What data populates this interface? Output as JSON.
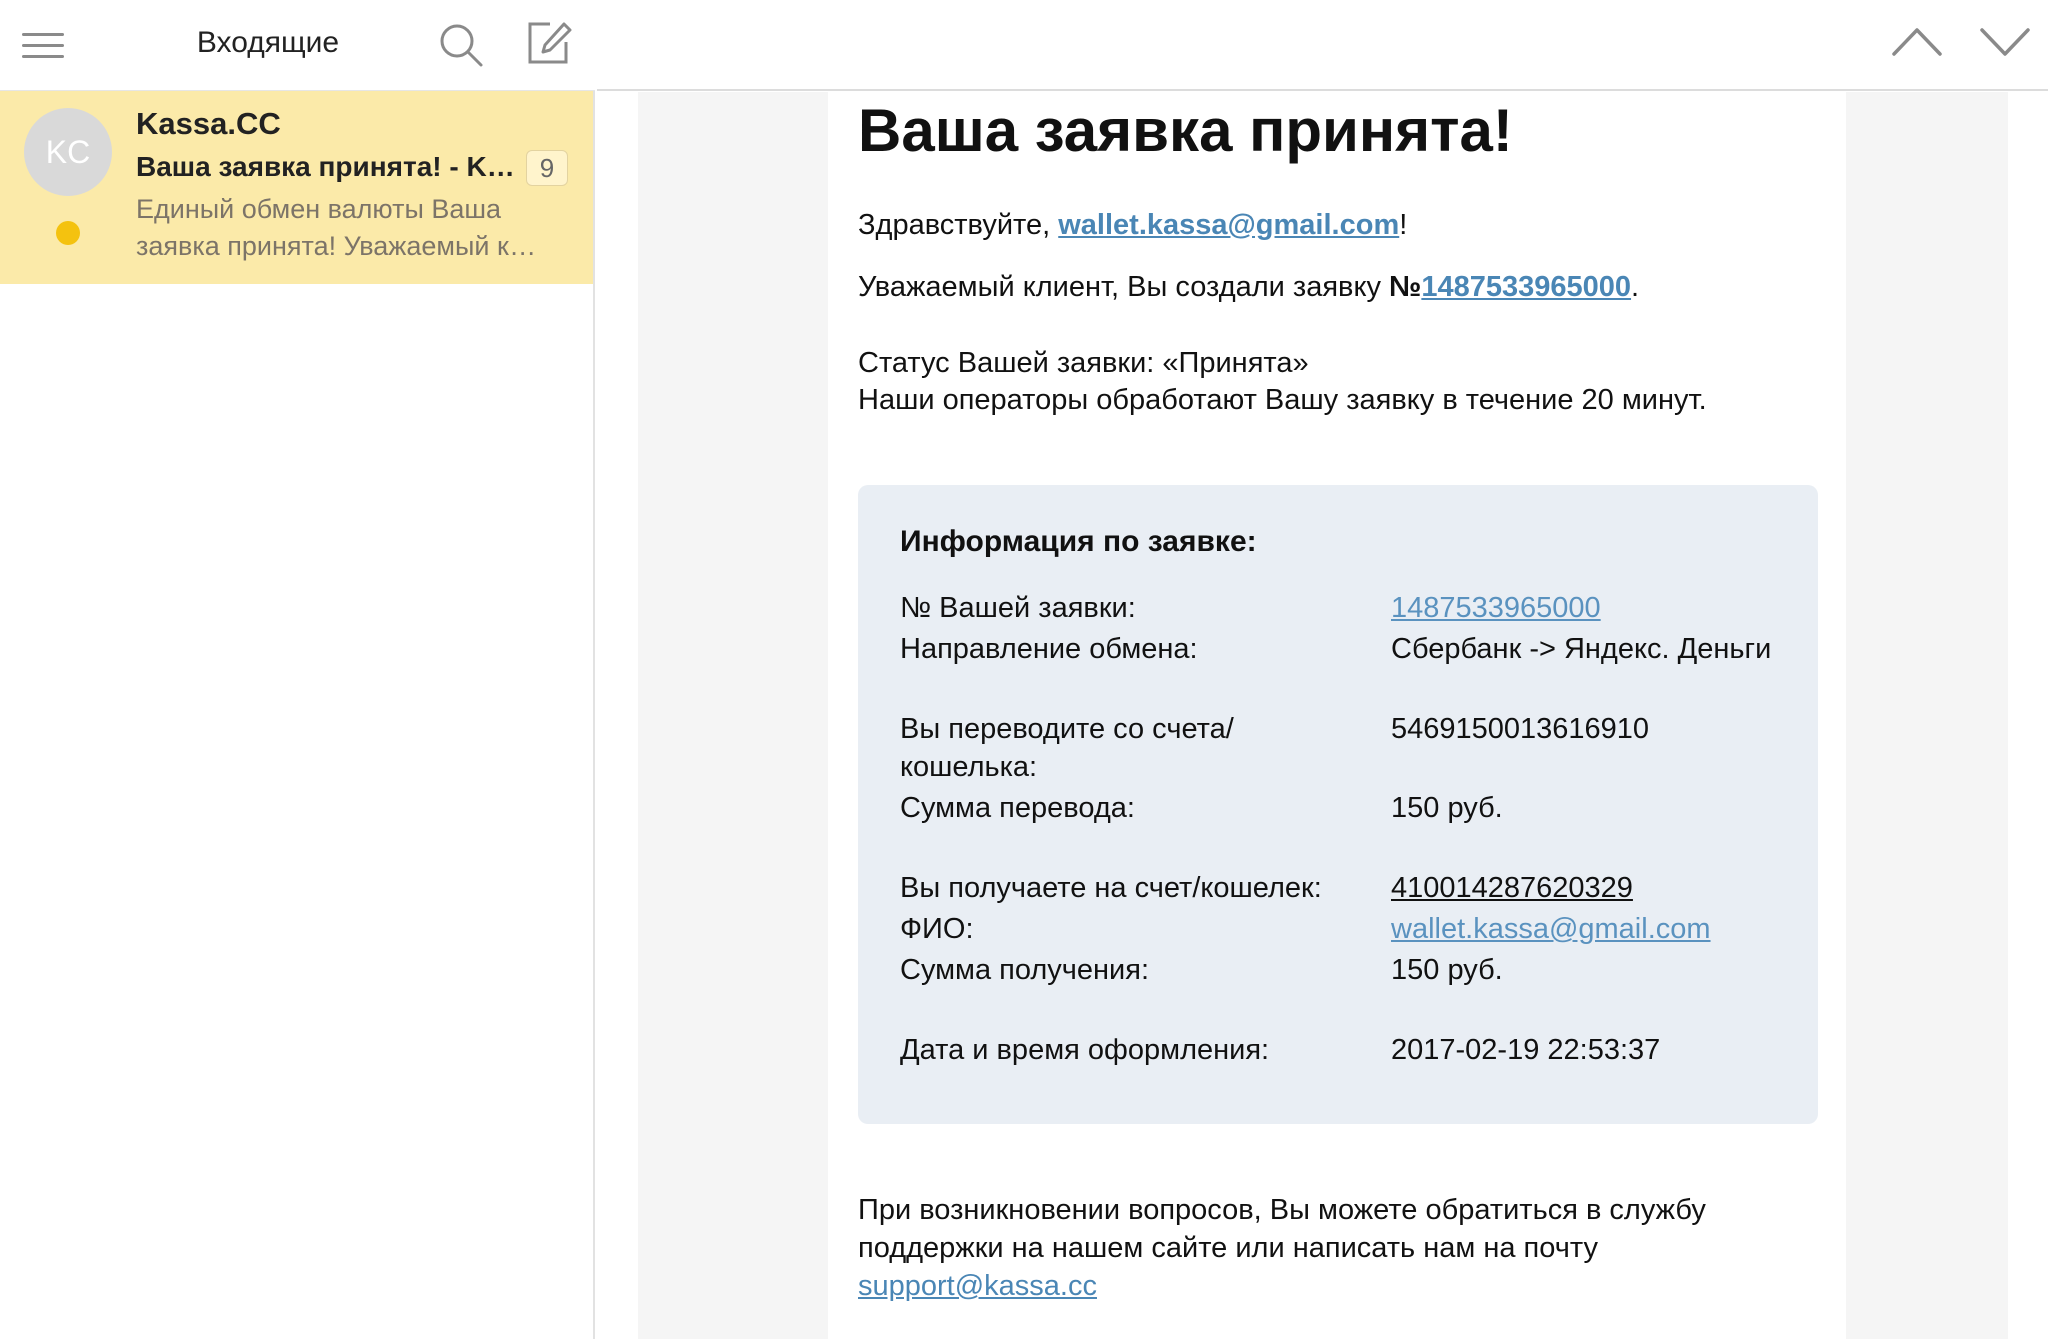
{
  "left_pane": {
    "header": {
      "title": "Входящие",
      "icons": [
        "menu-icon",
        "search-icon",
        "compose-icon"
      ]
    },
    "messages": [
      {
        "avatar_initials": "KC",
        "sender": "Kassa.CC",
        "subject": "Ваша заявка принята! - Kassa.CC",
        "count": "9",
        "snippet_line1": "Единый обмен валюты Ваша",
        "snippet_line2": "заявка принята! Уважаемый клиент",
        "unread": true
      }
    ]
  },
  "right_header": {
    "icons": [
      "chevron-up-icon",
      "chevron-down-icon"
    ]
  },
  "email": {
    "heading": "Ваша заявка принята!",
    "greeting_prefix": "Здравствуйте, ",
    "greeting_email": "wallet.kassa@gmail.com",
    "greeting_suffix": "!",
    "created_prefix": "Уважаемый клиент, Вы создали заявку ",
    "created_number_sign": "№",
    "created_number": "1487533965000",
    "created_suffix": ".",
    "status_line": "Статус Вашей заявки: «Принята»",
    "operators_line": "Наши операторы обработают Вашу заявку в течение 20 минут.",
    "info": {
      "title": "Информация по заявке:",
      "order_number_label": "№ Вашей заявки:",
      "order_number_value": "1487533965000",
      "direction_label": "Направление обмена:",
      "direction_value": "Сбербанк -> Яндекс. Деньги",
      "from_account_label_line1": "Вы переводите со счета/",
      "from_account_label_line2": "кошелька:",
      "from_account_value": "5469150013616910",
      "send_amount_label": "Сумма перевода:",
      "send_amount_value": "150 руб.",
      "to_account_label": "Вы получаете на счет/кошелек:",
      "to_account_value": "410014287620329",
      "fio_label": "ФИО:",
      "fio_value": "wallet.kassa@gmail.com",
      "receive_amount_label": "Сумма получения:",
      "receive_amount_value": "150 руб.",
      "date_label": "Дата и время оформления:",
      "date_value": "2017-02-19 22:53:37"
    },
    "footer_line1": "При возникновении вопросов, Вы можете обратиться в службу",
    "footer_line2": "поддержки на нашем сайте или написать нам на почту",
    "support_email": "support@kassa.cc"
  },
  "colors": {
    "selected_item_bg": "#fbeaa9",
    "unread_dot": "#f4c20f",
    "link": "#4a86b5",
    "info_box_bg": "#e9eef4"
  }
}
